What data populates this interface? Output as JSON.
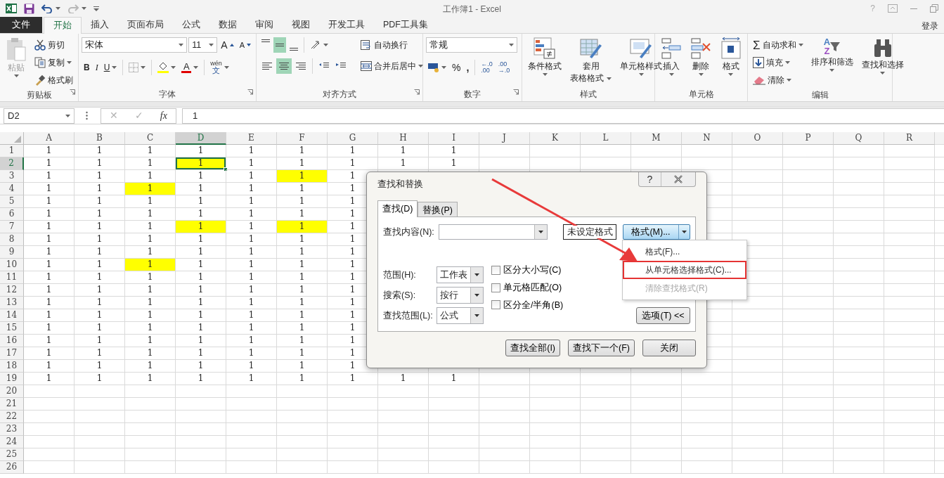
{
  "window": {
    "title": "工作簿1 - Excel",
    "help": "?"
  },
  "ribbon_tabs": [
    {
      "label": "文件",
      "kind": "file",
      "selected": false
    },
    {
      "label": "开始",
      "kind": "tab",
      "selected": true
    },
    {
      "label": "插入",
      "kind": "tab",
      "selected": false
    },
    {
      "label": "页面布局",
      "kind": "tab",
      "selected": false
    },
    {
      "label": "公式",
      "kind": "tab",
      "selected": false
    },
    {
      "label": "数据",
      "kind": "tab",
      "selected": false
    },
    {
      "label": "审阅",
      "kind": "tab",
      "selected": false
    },
    {
      "label": "视图",
      "kind": "tab",
      "selected": false
    },
    {
      "label": "开发工具",
      "kind": "tab",
      "selected": false
    },
    {
      "label": "PDF工具集",
      "kind": "tab",
      "selected": false
    }
  ],
  "account": {
    "label": "登录"
  },
  "ribbon": {
    "clipboard": {
      "title": "剪贴板",
      "paste": {
        "label": "粘贴",
        "disabled": true
      },
      "cut": "剪切",
      "copy": "复制",
      "painter": "格式刷"
    },
    "font": {
      "title": "字体",
      "font_name": "宋体",
      "font_size": "11",
      "grow": "A",
      "shrink": "A",
      "bold": "B",
      "italic": "I",
      "underline": "U",
      "font_color": "A",
      "phonetic_top": "wén",
      "phonetic_bottom": "文"
    },
    "alignment": {
      "title": "对齐方式",
      "vertical": [
        {
          "pressed": false
        },
        {
          "pressed": true
        },
        {
          "pressed": false
        }
      ],
      "horizontal": [
        {
          "pressed": false
        },
        {
          "pressed": true
        },
        {
          "pressed": false
        }
      ],
      "wrap": "自动换行",
      "merge": "合并后居中"
    },
    "number": {
      "title": "数字",
      "format": "常规",
      "percent": "%",
      "comma": ",",
      "decimals": [
        {
          "top": "←.0",
          "bottom": ".00"
        },
        {
          "top": ".00",
          "bottom": "→.0"
        }
      ]
    },
    "styles": {
      "title": "样式",
      "conditional": "条件格式",
      "table_top": "套用",
      "table_bottom": "表格格式",
      "cell_styles": "单元格样式"
    },
    "cells": {
      "title": "单元格",
      "insert": "插入",
      "delete": "删除",
      "format": "格式"
    },
    "editing": {
      "title": "编辑",
      "sum_symbol": "Σ",
      "autosum": "自动求和",
      "fill": "填充",
      "clear": "清除",
      "sort_letters": [
        "A",
        "Z"
      ],
      "sort": "排序和筛选",
      "find": "查找和选择"
    }
  },
  "formula_bar": {
    "name_box": "D2",
    "buttons": [
      {
        "label": "✕",
        "disabled": true
      },
      {
        "label": "✓",
        "disabled": true
      },
      {
        "label": "fx",
        "disabled": false
      }
    ],
    "formula": "1"
  },
  "sheet": {
    "columns": [
      {
        "label": "A",
        "selected": false
      },
      {
        "label": "B",
        "selected": false
      },
      {
        "label": "C",
        "selected": false
      },
      {
        "label": "D",
        "selected": true
      },
      {
        "label": "E",
        "selected": false
      },
      {
        "label": "F",
        "selected": false
      },
      {
        "label": "G",
        "selected": false
      },
      {
        "label": "H",
        "selected": false
      },
      {
        "label": "I",
        "selected": false
      },
      {
        "label": "J",
        "selected": false
      },
      {
        "label": "K",
        "selected": false
      },
      {
        "label": "L",
        "selected": false
      },
      {
        "label": "M",
        "selected": false
      },
      {
        "label": "N",
        "selected": false
      },
      {
        "label": "O",
        "selected": false
      },
      {
        "label": "P",
        "selected": false
      },
      {
        "label": "Q",
        "selected": false
      },
      {
        "label": "R",
        "selected": false
      }
    ],
    "rows": [
      {
        "label": "1",
        "selected": false,
        "cells": [
          {
            "text": "1",
            "highlighted": false
          },
          {
            "text": "1",
            "highlighted": false
          },
          {
            "text": "1",
            "highlighted": false
          },
          {
            "text": "1",
            "highlighted": false
          },
          {
            "text": "1",
            "highlighted": false
          },
          {
            "text": "1",
            "highlighted": false
          },
          {
            "text": "1",
            "highlighted": false
          },
          {
            "text": "1",
            "highlighted": false
          },
          {
            "text": "1",
            "highlighted": false
          }
        ]
      },
      {
        "label": "2",
        "selected": true,
        "cells": [
          {
            "text": "1",
            "highlighted": false
          },
          {
            "text": "1",
            "highlighted": false
          },
          {
            "text": "1",
            "highlighted": false
          },
          {
            "text": "1",
            "highlighted": true
          },
          {
            "text": "1",
            "highlighted": false
          },
          {
            "text": "1",
            "highlighted": false
          },
          {
            "text": "1",
            "highlighted": false
          },
          {
            "text": "1",
            "highlighted": false
          },
          {
            "text": "1",
            "highlighted": false
          }
        ]
      },
      {
        "label": "3",
        "selected": false,
        "cells": [
          {
            "text": "1",
            "highlighted": false
          },
          {
            "text": "1",
            "highlighted": false
          },
          {
            "text": "1",
            "highlighted": false
          },
          {
            "text": "1",
            "highlighted": false
          },
          {
            "text": "1",
            "highlighted": false
          },
          {
            "text": "1",
            "highlighted": true
          },
          {
            "text": "1",
            "highlighted": false
          }
        ]
      },
      {
        "label": "4",
        "selected": false,
        "cells": [
          {
            "text": "1",
            "highlighted": false
          },
          {
            "text": "1",
            "highlighted": false
          },
          {
            "text": "1",
            "highlighted": true
          },
          {
            "text": "1",
            "highlighted": false
          },
          {
            "text": "1",
            "highlighted": false
          },
          {
            "text": "1",
            "highlighted": false
          },
          {
            "text": "1",
            "highlighted": false
          }
        ]
      },
      {
        "label": "5",
        "selected": false,
        "cells": [
          {
            "text": "1",
            "highlighted": false
          },
          {
            "text": "1",
            "highlighted": false
          },
          {
            "text": "1",
            "highlighted": false
          },
          {
            "text": "1",
            "highlighted": false
          },
          {
            "text": "1",
            "highlighted": false
          },
          {
            "text": "1",
            "highlighted": false
          },
          {
            "text": "1",
            "highlighted": false
          }
        ]
      },
      {
        "label": "6",
        "selected": false,
        "cells": [
          {
            "text": "1",
            "highlighted": false
          },
          {
            "text": "1",
            "highlighted": false
          },
          {
            "text": "1",
            "highlighted": false
          },
          {
            "text": "1",
            "highlighted": false
          },
          {
            "text": "1",
            "highlighted": false
          },
          {
            "text": "1",
            "highlighted": false
          },
          {
            "text": "1",
            "highlighted": false
          }
        ]
      },
      {
        "label": "7",
        "selected": false,
        "cells": [
          {
            "text": "1",
            "highlighted": false
          },
          {
            "text": "1",
            "highlighted": false
          },
          {
            "text": "1",
            "highlighted": false
          },
          {
            "text": "1",
            "highlighted": true
          },
          {
            "text": "1",
            "highlighted": false
          },
          {
            "text": "1",
            "highlighted": true
          },
          {
            "text": "1",
            "highlighted": false
          }
        ]
      },
      {
        "label": "8",
        "selected": false,
        "cells": [
          {
            "text": "1",
            "highlighted": false
          },
          {
            "text": "1",
            "highlighted": false
          },
          {
            "text": "1",
            "highlighted": false
          },
          {
            "text": "1",
            "highlighted": false
          },
          {
            "text": "1",
            "highlighted": false
          },
          {
            "text": "1",
            "highlighted": false
          },
          {
            "text": "1",
            "highlighted": false
          }
        ]
      },
      {
        "label": "9",
        "selected": false,
        "cells": [
          {
            "text": "1",
            "highlighted": false
          },
          {
            "text": "1",
            "highlighted": false
          },
          {
            "text": "1",
            "highlighted": false
          },
          {
            "text": "1",
            "highlighted": false
          },
          {
            "text": "1",
            "highlighted": false
          },
          {
            "text": "1",
            "highlighted": false
          },
          {
            "text": "1",
            "highlighted": false
          }
        ]
      },
      {
        "label": "10",
        "selected": false,
        "cells": [
          {
            "text": "1",
            "highlighted": false
          },
          {
            "text": "1",
            "highlighted": false
          },
          {
            "text": "1",
            "highlighted": true
          },
          {
            "text": "1",
            "highlighted": false
          },
          {
            "text": "1",
            "highlighted": false
          },
          {
            "text": "1",
            "highlighted": false
          },
          {
            "text": "1",
            "highlighted": false
          }
        ]
      },
      {
        "label": "11",
        "selected": false,
        "cells": [
          {
            "text": "1",
            "highlighted": false
          },
          {
            "text": "1",
            "highlighted": false
          },
          {
            "text": "1",
            "highlighted": false
          },
          {
            "text": "1",
            "highlighted": false
          },
          {
            "text": "1",
            "highlighted": false
          },
          {
            "text": "1",
            "highlighted": false
          },
          {
            "text": "1",
            "highlighted": false
          }
        ]
      },
      {
        "label": "12",
        "selected": false,
        "cells": [
          {
            "text": "1",
            "highlighted": false
          },
          {
            "text": "1",
            "highlighted": false
          },
          {
            "text": "1",
            "highlighted": false
          },
          {
            "text": "1",
            "highlighted": false
          },
          {
            "text": "1",
            "highlighted": false
          },
          {
            "text": "1",
            "highlighted": false
          },
          {
            "text": "1",
            "highlighted": false
          }
        ]
      },
      {
        "label": "13",
        "selected": false,
        "cells": [
          {
            "text": "1",
            "highlighted": false
          },
          {
            "text": "1",
            "highlighted": false
          },
          {
            "text": "1",
            "highlighted": false
          },
          {
            "text": "1",
            "highlighted": false
          },
          {
            "text": "1",
            "highlighted": false
          },
          {
            "text": "1",
            "highlighted": false
          },
          {
            "text": "1",
            "highlighted": false
          }
        ]
      },
      {
        "label": "14",
        "selected": false,
        "cells": [
          {
            "text": "1",
            "highlighted": false
          },
          {
            "text": "1",
            "highlighted": false
          },
          {
            "text": "1",
            "highlighted": false
          },
          {
            "text": "1",
            "highlighted": false
          },
          {
            "text": "1",
            "highlighted": false
          },
          {
            "text": "1",
            "highlighted": false
          },
          {
            "text": "1",
            "highlighted": false
          }
        ]
      },
      {
        "label": "15",
        "selected": false,
        "cells": [
          {
            "text": "1",
            "highlighted": false
          },
          {
            "text": "1",
            "highlighted": false
          },
          {
            "text": "1",
            "highlighted": false
          },
          {
            "text": "1",
            "highlighted": false
          },
          {
            "text": "1",
            "highlighted": false
          },
          {
            "text": "1",
            "highlighted": false
          },
          {
            "text": "1",
            "highlighted": false
          }
        ]
      },
      {
        "label": "16",
        "selected": false,
        "cells": [
          {
            "text": "1",
            "highlighted": false
          },
          {
            "text": "1",
            "highlighted": false
          },
          {
            "text": "1",
            "highlighted": false
          },
          {
            "text": "1",
            "highlighted": false
          },
          {
            "text": "1",
            "highlighted": false
          },
          {
            "text": "1",
            "highlighted": false
          },
          {
            "text": "1",
            "highlighted": false
          }
        ]
      },
      {
        "label": "17",
        "selected": false,
        "cells": [
          {
            "text": "1",
            "highlighted": false
          },
          {
            "text": "1",
            "highlighted": false
          },
          {
            "text": "1",
            "highlighted": false
          },
          {
            "text": "1",
            "highlighted": false
          },
          {
            "text": "1",
            "highlighted": false
          },
          {
            "text": "1",
            "highlighted": false
          },
          {
            "text": "1",
            "highlighted": false
          }
        ]
      },
      {
        "label": "18",
        "selected": false,
        "cells": [
          {
            "text": "1",
            "highlighted": false
          },
          {
            "text": "1",
            "highlighted": false
          },
          {
            "text": "1",
            "highlighted": false
          },
          {
            "text": "1",
            "highlighted": false
          },
          {
            "text": "1",
            "highlighted": false
          },
          {
            "text": "1",
            "highlighted": false
          },
          {
            "text": "1",
            "highlighted": false
          }
        ]
      },
      {
        "label": "19",
        "selected": false,
        "cells": [
          {
            "text": "1",
            "highlighted": false
          },
          {
            "text": "1",
            "highlighted": false
          },
          {
            "text": "1",
            "highlighted": false
          },
          {
            "text": "1",
            "highlighted": false
          },
          {
            "text": "1",
            "highlighted": false
          },
          {
            "text": "1",
            "highlighted": false
          },
          {
            "text": "1",
            "highlighted": false
          },
          {
            "text": "1",
            "highlighted": false
          },
          {
            "text": "1",
            "highlighted": false
          }
        ]
      },
      {
        "label": "20",
        "selected": false
      },
      {
        "label": "21",
        "selected": false
      },
      {
        "label": "22",
        "selected": false
      },
      {
        "label": "23",
        "selected": false
      },
      {
        "label": "24",
        "selected": false
      },
      {
        "label": "25",
        "selected": false
      },
      {
        "label": "26",
        "selected": false
      }
    ]
  },
  "dialog": {
    "title": "查找和替换",
    "help": "?",
    "tabs": [
      {
        "label": "查找(D)",
        "selected": true
      },
      {
        "label": "替换(P)",
        "selected": false
      }
    ],
    "find_label": "查找内容(N):",
    "format_preview": "未设定格式",
    "format_button": "格式(M)...",
    "format_menu": [
      {
        "label": "格式(F)...",
        "disabled": false,
        "highlighted": false
      },
      {
        "label": "从单元格选择格式(C)...",
        "disabled": false,
        "highlighted": true
      },
      {
        "label": "清除查找格式(R)",
        "disabled": true,
        "highlighted": false
      }
    ],
    "options": [
      {
        "label": "范围(H):",
        "value": "工作表"
      },
      {
        "label": "搜索(S):",
        "value": "按行"
      },
      {
        "label": "查找范围(L):",
        "value": "公式"
      }
    ],
    "checkboxes": [
      {
        "label": "区分大小写(C)",
        "checked": false
      },
      {
        "label": "单元格匹配(O)",
        "checked": false
      },
      {
        "label": "区分全/半角(B)",
        "checked": false
      }
    ],
    "options_button": "选项(T) <<",
    "buttons": [
      "查找全部(I)",
      "查找下一个(F)",
      "关闭"
    ]
  }
}
